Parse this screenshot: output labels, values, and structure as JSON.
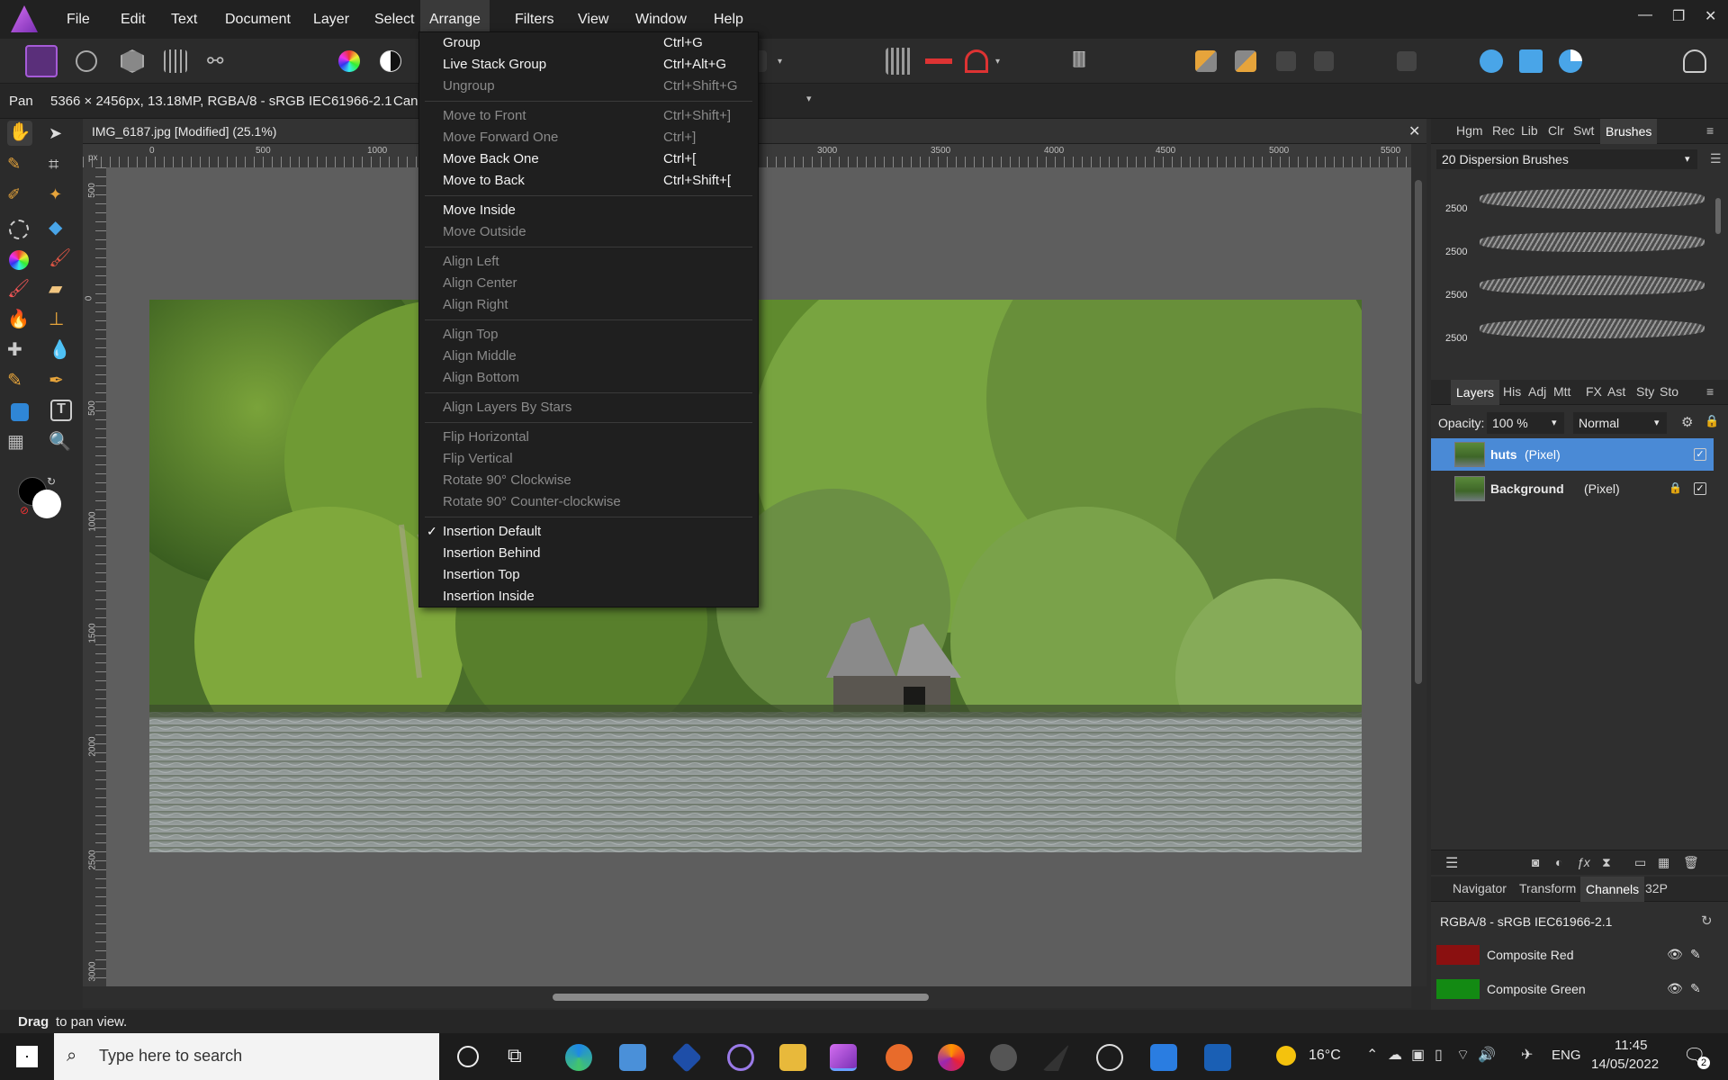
{
  "menubar": {
    "items": [
      "File",
      "Edit",
      "Text",
      "Document",
      "Layer",
      "Select",
      "Arrange",
      "Filters",
      "View",
      "Window",
      "Help"
    ],
    "active": "Arrange"
  },
  "context": {
    "tool": "Pan",
    "doc_info": "5366 × 2456px, 13.18MP, RGBA/8 - sRGB IEC61966-2.1",
    "extra": "Canc"
  },
  "document": {
    "tab_title": "IMG_6187.jpg [Modified] (25.1%)",
    "ruler_unit": "px",
    "h_ticks": [
      "0",
      "500",
      "1000",
      "3000",
      "3500",
      "4000",
      "4500",
      "5000",
      "5500"
    ],
    "v_ticks": [
      "500",
      "0",
      "500",
      "1000",
      "1500",
      "2000",
      "2500",
      "3000"
    ]
  },
  "arrange_menu": {
    "items": [
      {
        "label": "Group",
        "shortcut": "Ctrl+G",
        "enabled": true
      },
      {
        "label": "Live Stack Group",
        "shortcut": "Ctrl+Alt+G",
        "enabled": true
      },
      {
        "label": "Ungroup",
        "shortcut": "Ctrl+Shift+G",
        "enabled": false
      },
      {
        "sep": true
      },
      {
        "label": "Move to Front",
        "shortcut": "Ctrl+Shift+]",
        "enabled": false
      },
      {
        "label": "Move Forward One",
        "shortcut": "Ctrl+]",
        "enabled": false
      },
      {
        "label": "Move Back One",
        "shortcut": "Ctrl+[",
        "enabled": true
      },
      {
        "label": "Move to Back",
        "shortcut": "Ctrl+Shift+[",
        "enabled": true
      },
      {
        "sep": true
      },
      {
        "label": "Move Inside",
        "shortcut": "",
        "enabled": true
      },
      {
        "label": "Move Outside",
        "shortcut": "",
        "enabled": false
      },
      {
        "sep": true
      },
      {
        "label": "Align Left",
        "shortcut": "",
        "enabled": false
      },
      {
        "label": "Align Center",
        "shortcut": "",
        "enabled": false
      },
      {
        "label": "Align Right",
        "shortcut": "",
        "enabled": false
      },
      {
        "sep": true
      },
      {
        "label": "Align Top",
        "shortcut": "",
        "enabled": false
      },
      {
        "label": "Align Middle",
        "shortcut": "",
        "enabled": false
      },
      {
        "label": "Align Bottom",
        "shortcut": "",
        "enabled": false
      },
      {
        "sep": true
      },
      {
        "label": "Align Layers By Stars",
        "shortcut": "",
        "enabled": false
      },
      {
        "sep": true
      },
      {
        "label": "Flip Horizontal",
        "shortcut": "",
        "enabled": false
      },
      {
        "label": "Flip Vertical",
        "shortcut": "",
        "enabled": false
      },
      {
        "label": "Rotate 90° Clockwise",
        "shortcut": "",
        "enabled": false
      },
      {
        "label": "Rotate 90° Counter-clockwise",
        "shortcut": "",
        "enabled": false
      },
      {
        "sep": true
      },
      {
        "label": "Insertion Default",
        "shortcut": "",
        "enabled": true,
        "checked": true
      },
      {
        "label": "Insertion Behind",
        "shortcut": "",
        "enabled": true
      },
      {
        "label": "Insertion Top",
        "shortcut": "",
        "enabled": true
      },
      {
        "label": "Insertion Inside",
        "shortcut": "",
        "enabled": true
      }
    ]
  },
  "brushes_panel": {
    "tabs": [
      "Hgm",
      "Rec",
      "Lib",
      "Clr",
      "Swt",
      "Brushes"
    ],
    "selected_tab": "Brushes",
    "category": "20 Dispersion Brushes",
    "brush_sizes": [
      "2500",
      "2500",
      "2500",
      "2500"
    ]
  },
  "layers_panel": {
    "tabs": [
      "Layers",
      "His",
      "Adj",
      "Mtt",
      "FX",
      "Ast",
      "Sty",
      "Sto"
    ],
    "selected_tab": "Layers",
    "opacity_label": "Opacity:",
    "opacity_value": "100 %",
    "blend_mode": "Normal",
    "layers": [
      {
        "name": "huts",
        "type": "(Pixel)",
        "selected": true,
        "locked": false
      },
      {
        "name": "Background",
        "type": "(Pixel)",
        "selected": false,
        "locked": true
      }
    ]
  },
  "channels_panel": {
    "tabs": [
      "Navigator",
      "Transform",
      "Channels",
      "32P"
    ],
    "selected_tab": "Channels",
    "format": "RGBA/8 - sRGB IEC61966-2.1",
    "channels": [
      {
        "name": "Composite Red",
        "color": "#8a1010"
      },
      {
        "name": "Composite Green",
        "color": "#138a13"
      }
    ]
  },
  "status": {
    "bold": "Drag",
    "text": "to pan view."
  },
  "taskbar": {
    "search_placeholder": "Type here to search",
    "weather": "16°C",
    "lang": "ENG",
    "time": "11:45",
    "date": "14/05/2022",
    "notification_count": "2"
  },
  "colors": {
    "accent": "#4a8ad6",
    "menu_bg": "#1f1f1f",
    "app_bg": "#2b2b2b"
  }
}
